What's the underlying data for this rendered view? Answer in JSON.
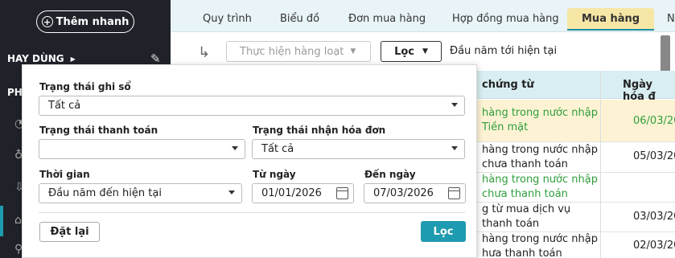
{
  "sidebar": {
    "quick_add_label": "Thêm nhanh",
    "section_label": "HAY DÙNG",
    "partial_label": "PH"
  },
  "tabs": [
    {
      "label": "Quy trình"
    },
    {
      "label": "Biểu đồ"
    },
    {
      "label": "Đơn mua hàng"
    },
    {
      "label": "Hợp đồng mua hàng"
    },
    {
      "label": "Mua hàng",
      "active": true
    },
    {
      "label": "N"
    }
  ],
  "toolbar": {
    "batch_label": "Thực hiện hàng loạt",
    "filter_label": "Lọc",
    "range_text": "Đầu năm tới hiện tại"
  },
  "table": {
    "headers": [
      "chứng từ",
      "Ngày hóa đ"
    ],
    "rows": [
      {
        "desc": [
          "hàng trong nước nhập",
          "Tiền mặt"
        ],
        "date": "06/03/20",
        "highlight": true,
        "green": true
      },
      {
        "desc": [
          "hàng trong nước nhập",
          "chưa thanh toán"
        ],
        "date": "05/03/20",
        "highlight": false,
        "green": false
      },
      {
        "desc": [
          "hàng trong nước nhập",
          "chưa thanh toán"
        ],
        "date": "",
        "highlight": false,
        "green": true
      },
      {
        "desc": [
          "g từ mua dịch vụ",
          "thanh toán"
        ],
        "date": "03/03/20",
        "highlight": false,
        "green": false
      },
      {
        "desc": [
          "hàng trong nước nhập",
          "hưa thanh toán"
        ],
        "date": "02/03/20",
        "highlight": false,
        "green": false
      }
    ]
  },
  "filter": {
    "posting_status_label": "Trạng thái ghi sổ",
    "posting_status_value": "Tất cả",
    "payment_status_label": "Trạng thái thanh toán",
    "payment_status_value": "",
    "invoice_status_label": "Trạng thái nhận hóa đơn",
    "invoice_status_value": "Tất cả",
    "period_label": "Thời gian",
    "period_value": "Đầu năm đến hiện tại",
    "from_label": "Từ ngày",
    "from_value": "01/01/2026",
    "to_label": "Đến ngày",
    "to_value": "07/03/2026",
    "reset_label": "Đặt lại",
    "apply_label": "Lọc"
  }
}
